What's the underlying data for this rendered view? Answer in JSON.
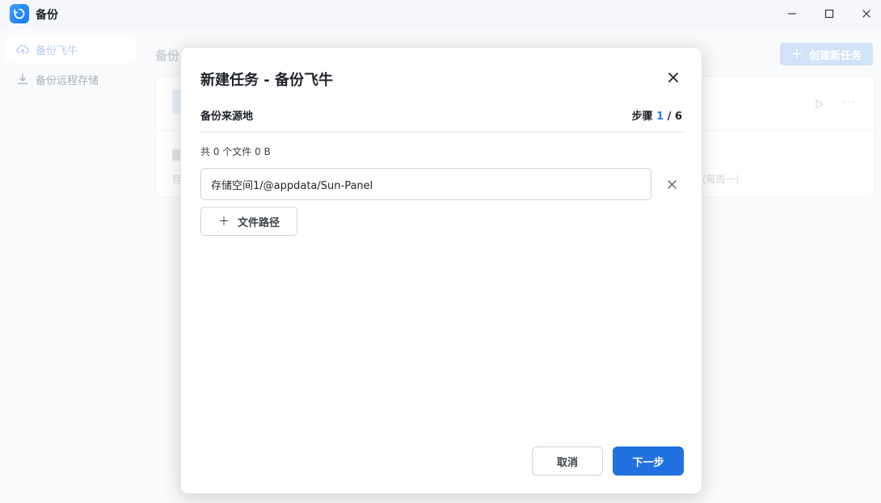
{
  "window": {
    "title": "备份",
    "icon": "backup-refresh-icon"
  },
  "sidebar": {
    "items": [
      {
        "label": "备份飞牛",
        "icon": "cloud-upload-icon",
        "active": true
      },
      {
        "label": "备份远程存储",
        "icon": "download-icon",
        "active": false
      }
    ]
  },
  "main": {
    "title": "备份",
    "create_button": "创建新任务",
    "task_card": {
      "storage_prefix": "存",
      "schedule_suffix": "(每周一)"
    }
  },
  "modal": {
    "title": "新建任务 - 备份飞牛",
    "section_label": "备份来源地",
    "step_prefix": "步骤",
    "step_current": "1",
    "step_total": "/ 6",
    "summary": "共 0 个文件 0 B",
    "paths": [
      {
        "value": "存储空间1/@appdata/Sun-Panel"
      }
    ],
    "add_path_label": "文件路径",
    "cancel_label": "取消",
    "next_label": "下一步"
  },
  "colors": {
    "primary": "#2271e0",
    "accent_text": "#2f7ae5",
    "sidebar_bg": "#f5f7fa"
  }
}
